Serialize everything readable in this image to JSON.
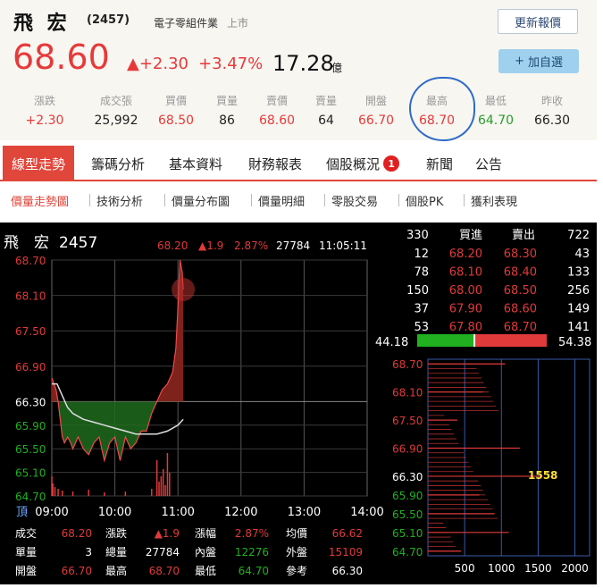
{
  "stock": {
    "name": "飛 宏",
    "code": "(2457)",
    "industry": "電子零組件業",
    "market": "上市",
    "price": "68.60",
    "change": "▲+2.30",
    "change_pct": "+3.47%",
    "volume": "17.28",
    "volume_unit": "億",
    "refresh_label": "更新報價",
    "watch_label": "加自選",
    "watch_icon": "plus-icon"
  },
  "stats": [
    {
      "label": "漲跌",
      "value": "+2.30",
      "color": "#e63a3a"
    },
    {
      "label": "成交張",
      "value": "25,992",
      "color": "#222222"
    },
    {
      "label": "買價",
      "value": "68.50",
      "color": "#e63a3a"
    },
    {
      "label": "買量",
      "value": "86",
      "color": "#222222"
    },
    {
      "label": "賣價",
      "value": "68.60",
      "color": "#e63a3a"
    },
    {
      "label": "賣量",
      "value": "64",
      "color": "#222222"
    },
    {
      "label": "開盤",
      "value": "66.70",
      "color": "#e63a3a"
    },
    {
      "label": "最高",
      "value": "68.70",
      "color": "#e63a3a"
    },
    {
      "label": "最低",
      "value": "64.70",
      "color": "#2a9d2a"
    },
    {
      "label": "昨收",
      "value": "66.30",
      "color": "#222222"
    }
  ],
  "tabs": [
    {
      "label": "線型走勢",
      "active": true
    },
    {
      "label": "籌碼分析"
    },
    {
      "label": "基本資料"
    },
    {
      "label": "財務報表"
    },
    {
      "label": "個股概況",
      "badge": "1"
    },
    {
      "label": "新聞"
    },
    {
      "label": "公告"
    }
  ],
  "subtabs": [
    {
      "label": "價量走勢圖",
      "active": true
    },
    {
      "label": "技術分析"
    },
    {
      "label": "價量分布圖"
    },
    {
      "label": "價量明細"
    },
    {
      "label": "零股交易"
    },
    {
      "label": "個股PK"
    },
    {
      "label": "獲利表現"
    }
  ],
  "chart_header": {
    "name": "飛　宏",
    "code": "2457",
    "price": "68.20",
    "change": "▲1.9",
    "pct": "2.87%",
    "volume": "27784",
    "time": "11:05:11"
  },
  "chart_data": [
    {
      "type": "line",
      "y_ticks": [
        "68.70",
        "68.10",
        "67.50",
        "66.90",
        "66.30",
        "65.90",
        "65.50",
        "65.10",
        "64.70"
      ],
      "ylim": [
        64.7,
        68.7
      ],
      "reference": 66.3,
      "x_ticks": [
        "09:00",
        "10:00",
        "11:00",
        "12:00",
        "13:00",
        "14:00"
      ],
      "x_prefix": "頂",
      "series": [
        {
          "x": [
            "09:00",
            "09:02",
            "09:04",
            "09:06",
            "09:08",
            "09:10",
            "09:12",
            "09:15",
            "09:18",
            "09:20",
            "09:25",
            "09:30",
            "09:35",
            "09:40",
            "09:45",
            "09:50",
            "09:55",
            "10:00",
            "10:05",
            "10:10",
            "10:15",
            "10:20",
            "10:25",
            "10:30",
            "10:35",
            "10:40",
            "10:45",
            "10:50",
            "10:55",
            "10:58",
            "11:00",
            "11:02",
            "11:04",
            "11:05"
          ],
          "values": [
            66.7,
            66.6,
            66.5,
            66.3,
            66.0,
            65.7,
            65.6,
            65.7,
            65.6,
            65.5,
            65.7,
            65.5,
            65.4,
            65.6,
            65.7,
            65.3,
            65.6,
            65.7,
            65.3,
            65.7,
            65.5,
            65.6,
            65.8,
            65.8,
            66.1,
            66.3,
            66.5,
            66.6,
            66.8,
            67.2,
            67.9,
            68.7,
            68.5,
            68.2
          ]
        },
        {
          "x": [
            "09:00",
            "09:05",
            "09:10",
            "09:15",
            "09:20",
            "09:30",
            "09:40",
            "09:50",
            "10:00",
            "10:10",
            "10:20",
            "10:30",
            "10:40",
            "10:50",
            "11:00",
            "11:05"
          ],
          "values": [
            66.6,
            66.6,
            66.4,
            66.2,
            66.1,
            66.0,
            65.95,
            65.9,
            65.85,
            65.8,
            65.75,
            65.75,
            65.75,
            65.8,
            65.9,
            66.0
          ]
        }
      ],
      "volume_ticks": [
        "頂"
      ]
    },
    {
      "type": "bar",
      "orientation": "horizontal",
      "title": "",
      "categories": [
        "68.70",
        "68.10",
        "67.50",
        "66.90",
        "66.30",
        "65.90",
        "65.50",
        "65.10",
        "64.70"
      ],
      "x_ticks": [
        "500",
        "1000",
        "1500",
        "2000"
      ],
      "xlim": [
        0,
        2200
      ],
      "highlight_label": "1558",
      "values": [
        1050,
        750,
        400,
        1250,
        1558,
        700,
        900,
        1100,
        450
      ]
    }
  ],
  "order_book": {
    "head": {
      "left": "330",
      "buy": "買進",
      "sell": "賣出",
      "right": "722"
    },
    "rows": [
      {
        "bid_vol": "12",
        "bid": "68.20",
        "ask": "68.30",
        "ask_vol": "43"
      },
      {
        "bid_vol": "78",
        "bid": "68.10",
        "ask": "68.40",
        "ask_vol": "133"
      },
      {
        "bid_vol": "150",
        "bid": "68.00",
        "ask": "68.50",
        "ask_vol": "256"
      },
      {
        "bid_vol": "37",
        "bid": "67.90",
        "ask": "68.60",
        "ask_vol": "149"
      },
      {
        "bid_vol": "53",
        "bid": "67.80",
        "ask": "68.70",
        "ask_vol": "141"
      }
    ],
    "ratio_left": "44.18",
    "ratio_right": "54.38",
    "ratio_fraction": 0.4418
  },
  "footer": [
    [
      {
        "k": "成交",
        "v": "68.20"
      },
      {
        "k": "漲跌",
        "v": "▲1.9"
      },
      {
        "k": "漲幅",
        "v": "2.87%"
      },
      {
        "k": "均價",
        "v": "66.62"
      }
    ],
    [
      {
        "k": "單量",
        "v": "3"
      },
      {
        "k": "總量",
        "v": "27784"
      },
      {
        "k": "內盤",
        "v": "12276"
      },
      {
        "k": "外盤",
        "v": "15109"
      }
    ],
    [
      {
        "k": "開盤",
        "v": "66.70"
      },
      {
        "k": "最高",
        "v": "68.70"
      },
      {
        "k": "最低",
        "v": "64.70"
      },
      {
        "k": "參考",
        "v": "66.30"
      }
    ]
  ]
}
